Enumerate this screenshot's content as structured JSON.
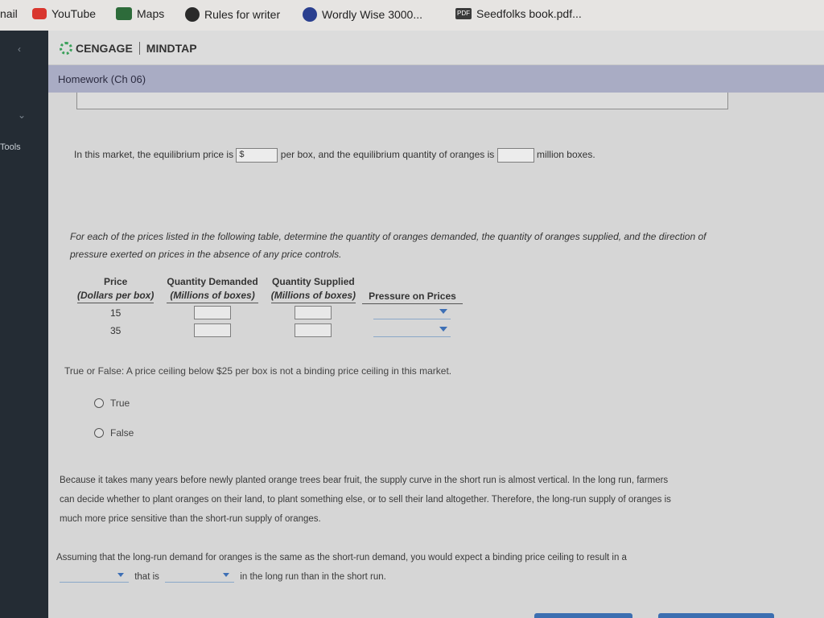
{
  "bookmarks": {
    "mail": "nail",
    "youtube": "YouTube",
    "maps": "Maps",
    "rules": "Rules for writer",
    "wordly": "Wordly Wise 3000...",
    "pdf_badge": "PDF",
    "seedfolks": "Seedfolks book.pdf..."
  },
  "sidebar": {
    "tools_label": "Tools"
  },
  "header": {
    "brand": "CENGAGE",
    "product": "MINDTAP"
  },
  "assignment": {
    "title": "Homework (Ch 06)"
  },
  "equilibrium": {
    "part1": "In this market, the equilibrium price is",
    "price_prefix": "$",
    "part2": "per box, and the equilibrium quantity of oranges is",
    "part3": "million boxes."
  },
  "table_prompt": {
    "line1": "For each of the prices listed in the following table, determine the quantity of oranges demanded, the quantity of oranges supplied, and the direction of",
    "line2": "pressure exerted on prices in the absence of any price controls."
  },
  "table": {
    "headers": {
      "price": "Price",
      "price_unit": "(Dollars per box)",
      "qd": "Quantity Demanded",
      "qd_unit": "(Millions of boxes)",
      "qs": "Quantity Supplied",
      "qs_unit": "(Millions of boxes)",
      "pressure": "Pressure on Prices"
    },
    "rows": [
      {
        "price": "15"
      },
      {
        "price": "35"
      }
    ]
  },
  "true_false": {
    "question": "True or False: A price ceiling below $25 per box is not a binding price ceiling in this market.",
    "options": [
      "True",
      "False"
    ]
  },
  "paragraph": {
    "line1": "Because it takes many years before newly planted orange trees bear fruit, the supply curve in the short run is almost vertical. In the long run, farmers",
    "line2": "can decide whether to plant oranges on their land, to plant something else, or to sell their land altogether. Therefore, the long-run supply of oranges is",
    "line3": "much more price sensitive than the short-run supply of oranges."
  },
  "final_question": {
    "line1": "Assuming that the long-run demand for oranges is the same as the short-run demand, you would expect a binding price ceiling to result in a",
    "mid": "that is",
    "end": "in the long run than in the short run."
  }
}
